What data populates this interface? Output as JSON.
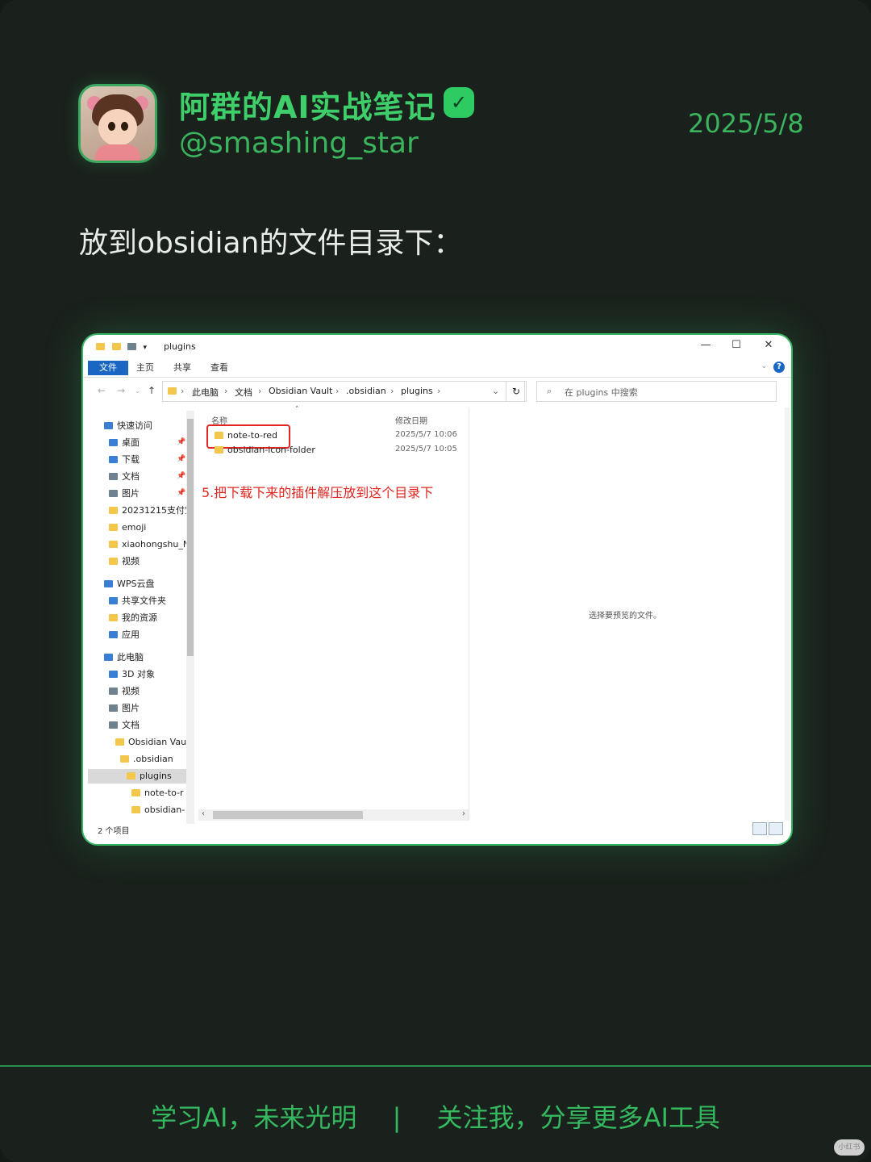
{
  "header": {
    "name": "阿群的AI实战笔记",
    "handle": "@smashing_star",
    "date": "2025/5/8",
    "verified_icon": "check-icon",
    "accent": "#3ecf6a"
  },
  "caption": "放到obsidian的文件目录下：",
  "explorer": {
    "window_title": "plugins",
    "window_buttons": {
      "minimize": "—",
      "maximize": "☐",
      "close": "✕"
    },
    "ribbon_tabs": [
      "文件",
      "主页",
      "共享",
      "查看"
    ],
    "help": "?",
    "breadcrumb": [
      "此电脑",
      "文档",
      "Obsidian Vault",
      ".obsidian",
      "plugins"
    ],
    "refresh": "↻",
    "search_placeholder": "在 plugins 中搜索",
    "nav_items": [
      {
        "label": "快速访问",
        "icon": "star-icon"
      },
      {
        "label": "桌面",
        "icon": "desktop-icon"
      },
      {
        "label": "下载",
        "icon": "download-icon"
      },
      {
        "label": "文档",
        "icon": "document-icon"
      },
      {
        "label": "图片",
        "icon": "picture-icon"
      },
      {
        "label": "20231215支付宝",
        "icon": "folder-icon"
      },
      {
        "label": "emoji",
        "icon": "folder-icon"
      },
      {
        "label": "xiaohongshu_N",
        "icon": "folder-icon"
      },
      {
        "label": "视频",
        "icon": "folder-icon"
      },
      {
        "label": "WPS云盘",
        "icon": "cloud-icon"
      },
      {
        "label": "共享文件夹",
        "icon": "share-icon"
      },
      {
        "label": "我的资源",
        "icon": "folder-icon"
      },
      {
        "label": "应用",
        "icon": "apps-icon"
      },
      {
        "label": "此电脑",
        "icon": "computer-icon"
      },
      {
        "label": "3D 对象",
        "icon": "cube-icon"
      },
      {
        "label": "视频",
        "icon": "video-icon"
      },
      {
        "label": "图片",
        "icon": "picture-icon"
      },
      {
        "label": "文档",
        "icon": "document-icon"
      },
      {
        "label": "Obsidian Vau",
        "icon": "folder-icon"
      },
      {
        "label": ".obsidian",
        "icon": "folder-icon"
      },
      {
        "label": "plugins",
        "icon": "folder-icon"
      },
      {
        "label": "note-to-r",
        "icon": "folder-icon"
      },
      {
        "label": "obsidian-",
        "icon": "folder-icon"
      }
    ],
    "columns": {
      "name": "名称",
      "date": "修改日期"
    },
    "files": [
      {
        "name": "note-to-red",
        "date": "2025/5/7 10:06"
      },
      {
        "name": "obsidian-icon-folder",
        "date": "2025/5/7 10:05"
      }
    ],
    "annotation": "5.把下载下来的插件解压放到这个目录下",
    "preview_text": "选择要预览的文件。",
    "status": "2 个项目"
  },
  "footer": {
    "left": "学习AI，未来光明",
    "separator": "|",
    "right": "关注我，分享更多AI工具"
  },
  "watermark": "小红书"
}
